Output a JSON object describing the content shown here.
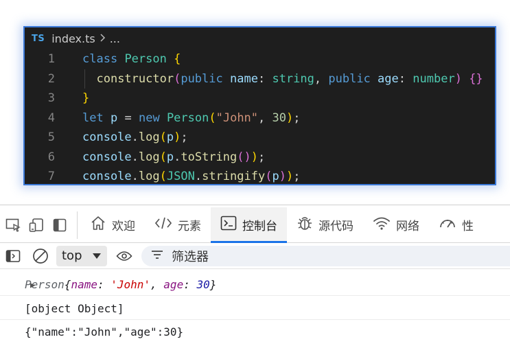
{
  "editor": {
    "lang_badge": "TS",
    "file_name": "index.ts",
    "breadcrumb_more": "...",
    "lines": [
      {
        "no": "1"
      },
      {
        "no": "2"
      },
      {
        "no": "3"
      },
      {
        "no": "4"
      },
      {
        "no": "5"
      },
      {
        "no": "6"
      },
      {
        "no": "7"
      }
    ],
    "tokens": {
      "class": "class",
      "Person": "Person",
      "lbrace": "{",
      "rbrace": "}",
      "constructor": "constructor",
      "lparen": "(",
      "rparen": ")",
      "public": "public",
      "name": "name",
      "colon": ":",
      "string": "string",
      "comma": ",",
      "age": "age",
      "number": "number",
      "empty_braces": "{}",
      "let": "let",
      "p": "p",
      "eq": "=",
      "new": "new",
      "john": "\"John\"",
      "thirty": "30",
      "semicolon": ";",
      "console": "console",
      "dot": ".",
      "log": "log",
      "toString": "toString",
      "call_parens": "()",
      "JSON": "JSON",
      "stringify": "stringify"
    }
  },
  "devtools": {
    "tabs": [
      {
        "label": "欢迎"
      },
      {
        "label": "元素"
      },
      {
        "label": "控制台"
      },
      {
        "label": "源代码"
      },
      {
        "label": "网络"
      },
      {
        "label": "性"
      }
    ],
    "toolbar": {
      "context": "top",
      "filter_placeholder": "筛选器"
    },
    "messages": {
      "obj_class": "Person",
      "obj_open": "{",
      "obj_k1": "name",
      "obj_v1": "'John'",
      "obj_k2": "age",
      "obj_v2": "30",
      "obj_close": "}",
      "to_string": "[object Object]",
      "json": "{\"name\":\"John\",\"age\":30}"
    }
  }
}
